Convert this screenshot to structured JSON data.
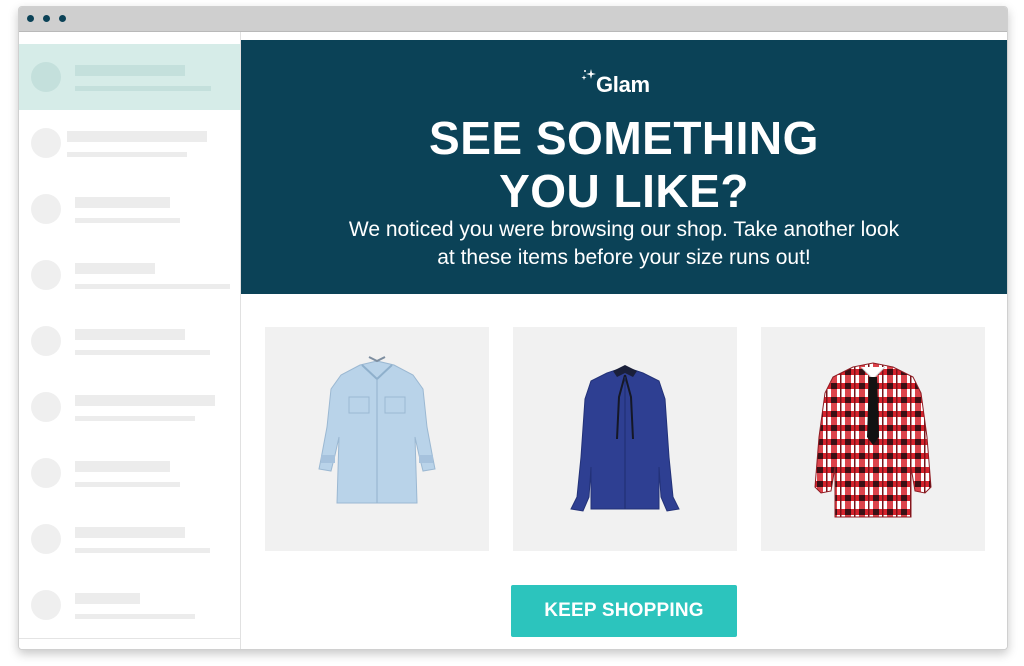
{
  "colors": {
    "brand_dark": "#0b4257",
    "accent": "#2cc4bd",
    "sidebar_active": "#d6ece8",
    "product_bg": "#f1f1f1"
  },
  "window": {
    "controls": [
      "close-dot",
      "minimize-dot",
      "maximize-dot"
    ]
  },
  "inbox": {
    "rows": 9,
    "active_row": 0
  },
  "email": {
    "brand": "Glam",
    "headline_line1": "SEE SOMETHING",
    "headline_line2": "YOU LIKE?",
    "subtext_line1": "We noticed you were browsing our shop. Take another look",
    "subtext_line2": "at these items before your size runs out!",
    "products": [
      {
        "icon": "denim-shirt-image"
      },
      {
        "icon": "navy-blouse-image"
      },
      {
        "icon": "plaid-shirt-image"
      }
    ],
    "cta_label": "KEEP SHOPPING"
  }
}
